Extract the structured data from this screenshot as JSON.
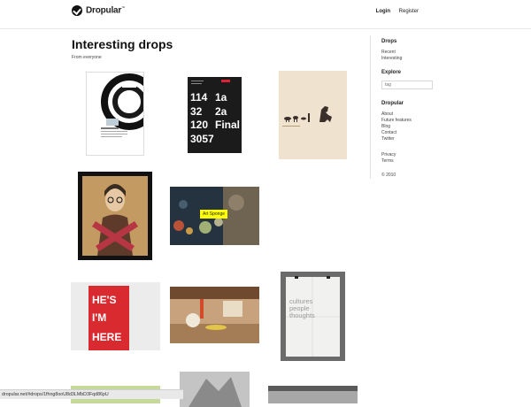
{
  "header": {
    "logo_text": "Dropular",
    "logo_mark": "™",
    "nav": {
      "login": "Login",
      "register": "Register"
    }
  },
  "main": {
    "title": "Interesting drops",
    "subtitle": "From everyone"
  },
  "sidebar": {
    "drops_heading": "Drops",
    "drops_links": [
      "Recent",
      "Interesting"
    ],
    "explore_heading": "Explore",
    "tag_placeholder": "tag",
    "dropular_heading": "Dropular",
    "dropular_links": [
      "About",
      "Future features",
      "Blog",
      "Contact",
      "Twitter"
    ],
    "legal_links": [
      "Privacy",
      "Terms"
    ],
    "copyright": "© 2010"
  },
  "thumbs": {
    "t2_lines": [
      "114",
      "32",
      "120",
      "3057"
    ],
    "t2_lines_b": [
      "1a",
      "2a",
      "Final"
    ],
    "t8_text": [
      "cultures",
      "people",
      "thoughts"
    ],
    "t6_text": [
      "HE'S",
      "I'M",
      "HERE"
    ]
  },
  "tooltip": "Art Sponge",
  "statusbar": "dropular.net/#drops/1fhng8ooU8d3LMbD3Fqd86pU",
  "colors": {
    "tooltip": "#ffff00",
    "divider": "#e6e6e6"
  }
}
